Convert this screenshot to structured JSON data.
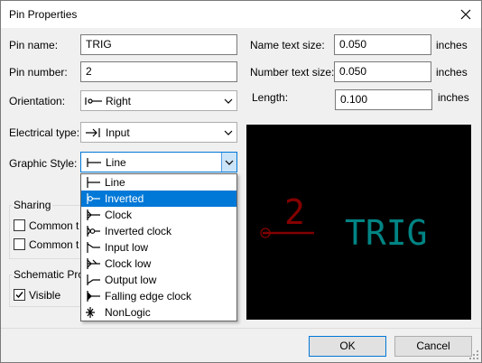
{
  "window": {
    "title": "Pin Properties"
  },
  "left": {
    "pin_name_label": "Pin name:",
    "pin_name_value": "TRIG",
    "pin_number_label": "Pin number:",
    "pin_number_value": "2",
    "orientation_label": "Orientation:",
    "orientation_value": "Right",
    "electrical_type_label": "Electrical type:",
    "electrical_type_value": "Input",
    "graphic_style_label": "Graphic Style:",
    "graphic_style_value": "Line"
  },
  "right": {
    "name_text_size_label": "Name text size:",
    "name_text_size_value": "0.050",
    "name_text_size_unit": "inches",
    "number_text_size_label": "Number text size:",
    "number_text_size_value": "0.050",
    "number_text_size_unit": "inches",
    "length_label": "Length:",
    "length_value": "0.100",
    "length_unit": "inches"
  },
  "sharing": {
    "title": "Sharing",
    "common1_label": "Common t",
    "common2_label": "Common t"
  },
  "schematic": {
    "title": "Schematic Pro",
    "visible_label": "Visible",
    "visible_checked": true
  },
  "preview": {
    "pin_number": "2",
    "pin_name": "TRIG",
    "number_color": "#840000",
    "name_color": "#008484",
    "background": "#000000"
  },
  "graphic_style_options": [
    {
      "label": "Line",
      "icon": "line-style-icon",
      "selected": false
    },
    {
      "label": "Inverted",
      "icon": "inverted-style-icon",
      "selected": true
    },
    {
      "label": "Clock",
      "icon": "clock-style-icon",
      "selected": false
    },
    {
      "label": "Inverted clock",
      "icon": "inverted-clock-style-icon",
      "selected": false
    },
    {
      "label": "Input low",
      "icon": "input-low-style-icon",
      "selected": false
    },
    {
      "label": "Clock low",
      "icon": "clock-low-style-icon",
      "selected": false
    },
    {
      "label": "Output low",
      "icon": "output-low-style-icon",
      "selected": false
    },
    {
      "label": "Falling edge clock",
      "icon": "falling-edge-clock-style-icon",
      "selected": false
    },
    {
      "label": "NonLogic",
      "icon": "nonlogic-style-icon",
      "selected": false
    }
  ],
  "buttons": {
    "ok": "OK",
    "cancel": "Cancel"
  },
  "colors": {
    "accent": "#0078d7",
    "selection": "#0078d7"
  }
}
